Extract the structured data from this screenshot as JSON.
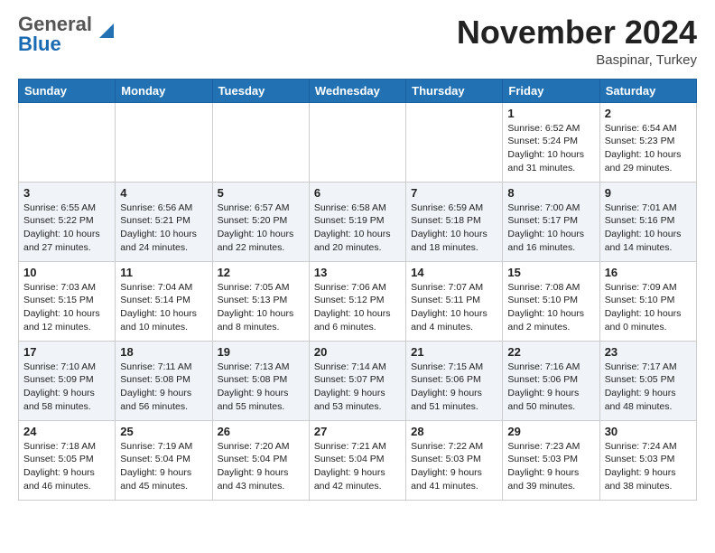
{
  "header": {
    "logo_general": "General",
    "logo_blue": "Blue",
    "month": "November 2024",
    "location": "Baspinar, Turkey"
  },
  "weekdays": [
    "Sunday",
    "Monday",
    "Tuesday",
    "Wednesday",
    "Thursday",
    "Friday",
    "Saturday"
  ],
  "weeks": [
    [
      {
        "day": "",
        "info": ""
      },
      {
        "day": "",
        "info": ""
      },
      {
        "day": "",
        "info": ""
      },
      {
        "day": "",
        "info": ""
      },
      {
        "day": "",
        "info": ""
      },
      {
        "day": "1",
        "info": "Sunrise: 6:52 AM\nSunset: 5:24 PM\nDaylight: 10 hours\nand 31 minutes."
      },
      {
        "day": "2",
        "info": "Sunrise: 6:54 AM\nSunset: 5:23 PM\nDaylight: 10 hours\nand 29 minutes."
      }
    ],
    [
      {
        "day": "3",
        "info": "Sunrise: 6:55 AM\nSunset: 5:22 PM\nDaylight: 10 hours\nand 27 minutes."
      },
      {
        "day": "4",
        "info": "Sunrise: 6:56 AM\nSunset: 5:21 PM\nDaylight: 10 hours\nand 24 minutes."
      },
      {
        "day": "5",
        "info": "Sunrise: 6:57 AM\nSunset: 5:20 PM\nDaylight: 10 hours\nand 22 minutes."
      },
      {
        "day": "6",
        "info": "Sunrise: 6:58 AM\nSunset: 5:19 PM\nDaylight: 10 hours\nand 20 minutes."
      },
      {
        "day": "7",
        "info": "Sunrise: 6:59 AM\nSunset: 5:18 PM\nDaylight: 10 hours\nand 18 minutes."
      },
      {
        "day": "8",
        "info": "Sunrise: 7:00 AM\nSunset: 5:17 PM\nDaylight: 10 hours\nand 16 minutes."
      },
      {
        "day": "9",
        "info": "Sunrise: 7:01 AM\nSunset: 5:16 PM\nDaylight: 10 hours\nand 14 minutes."
      }
    ],
    [
      {
        "day": "10",
        "info": "Sunrise: 7:03 AM\nSunset: 5:15 PM\nDaylight: 10 hours\nand 12 minutes."
      },
      {
        "day": "11",
        "info": "Sunrise: 7:04 AM\nSunset: 5:14 PM\nDaylight: 10 hours\nand 10 minutes."
      },
      {
        "day": "12",
        "info": "Sunrise: 7:05 AM\nSunset: 5:13 PM\nDaylight: 10 hours\nand 8 minutes."
      },
      {
        "day": "13",
        "info": "Sunrise: 7:06 AM\nSunset: 5:12 PM\nDaylight: 10 hours\nand 6 minutes."
      },
      {
        "day": "14",
        "info": "Sunrise: 7:07 AM\nSunset: 5:11 PM\nDaylight: 10 hours\nand 4 minutes."
      },
      {
        "day": "15",
        "info": "Sunrise: 7:08 AM\nSunset: 5:10 PM\nDaylight: 10 hours\nand 2 minutes."
      },
      {
        "day": "16",
        "info": "Sunrise: 7:09 AM\nSunset: 5:10 PM\nDaylight: 10 hours\nand 0 minutes."
      }
    ],
    [
      {
        "day": "17",
        "info": "Sunrise: 7:10 AM\nSunset: 5:09 PM\nDaylight: 9 hours\nand 58 minutes."
      },
      {
        "day": "18",
        "info": "Sunrise: 7:11 AM\nSunset: 5:08 PM\nDaylight: 9 hours\nand 56 minutes."
      },
      {
        "day": "19",
        "info": "Sunrise: 7:13 AM\nSunset: 5:08 PM\nDaylight: 9 hours\nand 55 minutes."
      },
      {
        "day": "20",
        "info": "Sunrise: 7:14 AM\nSunset: 5:07 PM\nDaylight: 9 hours\nand 53 minutes."
      },
      {
        "day": "21",
        "info": "Sunrise: 7:15 AM\nSunset: 5:06 PM\nDaylight: 9 hours\nand 51 minutes."
      },
      {
        "day": "22",
        "info": "Sunrise: 7:16 AM\nSunset: 5:06 PM\nDaylight: 9 hours\nand 50 minutes."
      },
      {
        "day": "23",
        "info": "Sunrise: 7:17 AM\nSunset: 5:05 PM\nDaylight: 9 hours\nand 48 minutes."
      }
    ],
    [
      {
        "day": "24",
        "info": "Sunrise: 7:18 AM\nSunset: 5:05 PM\nDaylight: 9 hours\nand 46 minutes."
      },
      {
        "day": "25",
        "info": "Sunrise: 7:19 AM\nSunset: 5:04 PM\nDaylight: 9 hours\nand 45 minutes."
      },
      {
        "day": "26",
        "info": "Sunrise: 7:20 AM\nSunset: 5:04 PM\nDaylight: 9 hours\nand 43 minutes."
      },
      {
        "day": "27",
        "info": "Sunrise: 7:21 AM\nSunset: 5:04 PM\nDaylight: 9 hours\nand 42 minutes."
      },
      {
        "day": "28",
        "info": "Sunrise: 7:22 AM\nSunset: 5:03 PM\nDaylight: 9 hours\nand 41 minutes."
      },
      {
        "day": "29",
        "info": "Sunrise: 7:23 AM\nSunset: 5:03 PM\nDaylight: 9 hours\nand 39 minutes."
      },
      {
        "day": "30",
        "info": "Sunrise: 7:24 AM\nSunset: 5:03 PM\nDaylight: 9 hours\nand 38 minutes."
      }
    ]
  ]
}
